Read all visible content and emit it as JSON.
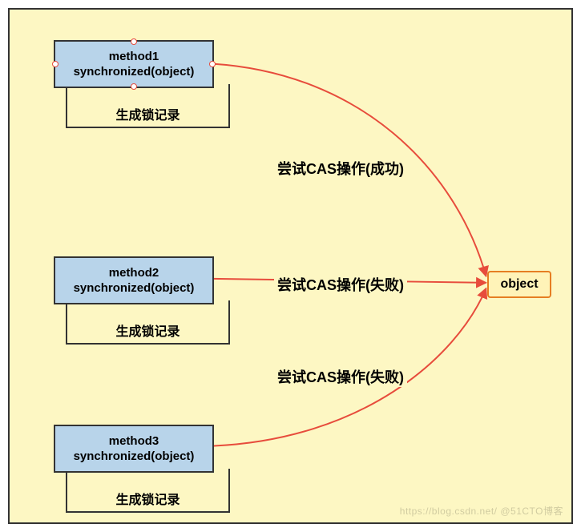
{
  "diagram": {
    "background": "#fdf7c3",
    "border_color": "#333333",
    "method_fill": "#b8d4ea",
    "object_fill": "#fff3b8",
    "object_border": "#e67e22",
    "edge_color": "#e74c3c"
  },
  "methods": [
    {
      "name": "method1",
      "lock_expr": "synchronized(object)",
      "lock_record_label": "生成锁记录",
      "selected": true
    },
    {
      "name": "method2",
      "lock_expr": "synchronized(object)",
      "lock_record_label": "生成锁记录",
      "selected": false
    },
    {
      "name": "method3",
      "lock_expr": "synchronized(object)",
      "lock_record_label": "生成锁记录",
      "selected": false
    }
  ],
  "target": {
    "label": "object"
  },
  "edges": [
    {
      "from": "method1",
      "label": "尝试CAS操作(成功)",
      "result": "success"
    },
    {
      "from": "method2",
      "label": "尝试CAS操作(失败)",
      "result": "fail"
    },
    {
      "from": "method3",
      "label": "尝试CAS操作(失败)",
      "result": "fail"
    }
  ],
  "watermark": "https://blog.csdn.net/   @51CTO博客"
}
